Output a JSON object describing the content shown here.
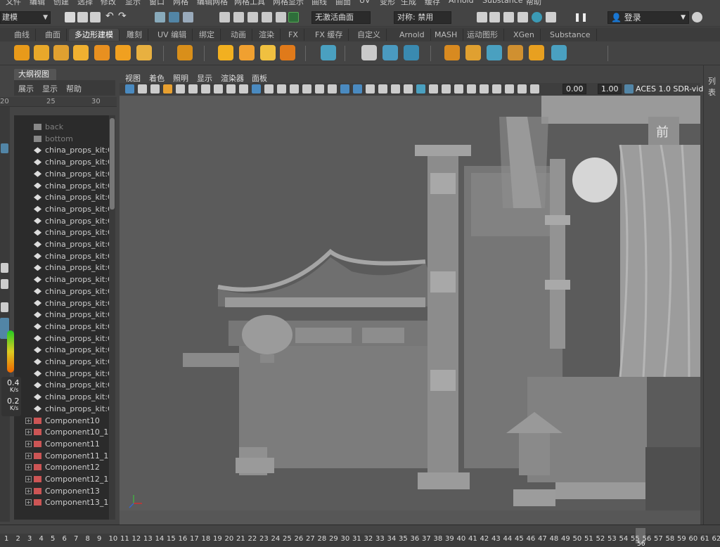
{
  "menubar": {
    "items": [
      "文件",
      "编辑",
      "创建",
      "选择",
      "修改",
      "显示",
      "窗口",
      "网格",
      "编辑网格",
      "网格工具",
      "网格显示",
      "曲线",
      "曲面",
      "UV",
      "变形",
      "生成",
      "缓存",
      "Arnold",
      "Substance",
      "帮助"
    ]
  },
  "statusline": {
    "mode": "建模",
    "live_surface": "无激活曲面",
    "symmetry": "对称: 禁用",
    "login": "登录"
  },
  "shelf_tabs": [
    "曲线",
    "曲面",
    "多边形建模",
    "雕刻",
    "UV 编辑",
    "绑定",
    "动画",
    "渲染",
    "FX",
    "FX 缓存",
    "自定义",
    "Arnold",
    "MASH",
    "运动图形",
    "XGen",
    "Substance"
  ],
  "shelf_active": "多边形建模",
  "shelf_icons": [
    "sphere-icon",
    "cube-icon",
    "cylinder-icon",
    "cone-icon",
    "torus-icon",
    "plane-icon",
    "disc-icon",
    "platonic-icon",
    "super-shape-icon",
    "sweep-mesh-icon",
    "text-icon",
    "svg-icon",
    "sphere-uv-icon",
    "combine-icon",
    "separate-icon",
    "smooth-icon",
    "boolean-icon",
    "bridge-icon",
    "extrude-icon",
    "bevel-icon",
    "merge-icon",
    "insert-loop-icon"
  ],
  "outliner": {
    "title": "大纲视图",
    "menu": [
      "展示",
      "显示",
      "帮助"
    ],
    "ruler": [
      "20",
      "25",
      "30"
    ],
    "items": [
      {
        "label": "back",
        "dim": true,
        "type": "camera"
      },
      {
        "label": "bottom",
        "dim": true,
        "type": "camera"
      },
      {
        "label": "china_props_kit:Gr",
        "type": "group"
      },
      {
        "label": "china_props_kit:Gr",
        "type": "group"
      },
      {
        "label": "china_props_kit:Gr",
        "type": "group"
      },
      {
        "label": "china_props_kit:Gr",
        "type": "group"
      },
      {
        "label": "china_props_kit:Gr",
        "type": "group"
      },
      {
        "label": "china_props_kit:Gr",
        "type": "group"
      },
      {
        "label": "china_props_kit:Gr",
        "type": "group"
      },
      {
        "label": "china_props_kit:Gr",
        "type": "group"
      },
      {
        "label": "china_props_kit:Gr",
        "type": "group"
      },
      {
        "label": "china_props_kit:Gr",
        "type": "group"
      },
      {
        "label": "china_props_kit:Gr",
        "type": "group"
      },
      {
        "label": "china_props_kit:Gr",
        "type": "group"
      },
      {
        "label": "china_props_kit:Gr",
        "type": "group"
      },
      {
        "label": "china_props_kit:Gr",
        "type": "group"
      },
      {
        "label": "china_props_kit:Gr",
        "type": "group"
      },
      {
        "label": "china_props_kit:Gr",
        "type": "group"
      },
      {
        "label": "china_props_kit:Gr",
        "type": "group"
      },
      {
        "label": "china_props_kit:Gr",
        "type": "group"
      },
      {
        "label": "china_props_kit:Gr",
        "type": "group"
      },
      {
        "label": "china_props_kit:Gr",
        "type": "group"
      },
      {
        "label": "china_props_kit:Gr",
        "type": "group"
      },
      {
        "label": "china_props_kit:Gr",
        "type": "group"
      },
      {
        "label": "china_props_kit:Gr",
        "type": "group"
      },
      {
        "label": "Component10",
        "type": "component"
      },
      {
        "label": "Component10_1",
        "type": "component"
      },
      {
        "label": "Component11",
        "type": "component"
      },
      {
        "label": "Component11_1",
        "type": "component"
      },
      {
        "label": "Component12",
        "type": "component"
      },
      {
        "label": "Component12_1",
        "type": "component"
      },
      {
        "label": "Component13",
        "type": "component"
      },
      {
        "label": "Component13_1",
        "type": "component"
      }
    ]
  },
  "speed_widget": {
    "up": "0.4",
    "up_unit": "K/s",
    "down": "0.2",
    "down_unit": "K/s"
  },
  "viewport": {
    "menu": [
      "视图",
      "着色",
      "照明",
      "显示",
      "渲染器",
      "面板"
    ],
    "exposure": "0.00",
    "gamma": "1.00",
    "color_space": "ACES 1.0 SDR-vide",
    "sign_text": "前"
  },
  "right_panel": {
    "label": "列表"
  },
  "time_slider": {
    "numbers": [
      "1",
      "2",
      "3",
      "4",
      "5",
      "6",
      "7",
      "8",
      "9",
      "10",
      "11",
      "12",
      "13",
      "14",
      "15",
      "16",
      "17",
      "18",
      "19",
      "20",
      "21",
      "22",
      "23",
      "24",
      "25",
      "26",
      "27",
      "28",
      "29",
      "30",
      "31",
      "32",
      "33",
      "34",
      "35",
      "36",
      "37",
      "38",
      "39",
      "40",
      "41",
      "42",
      "43",
      "44",
      "45",
      "46",
      "47",
      "48",
      "49",
      "50",
      "51",
      "52",
      "53",
      "54",
      "55",
      "56",
      "57",
      "58",
      "59",
      "60",
      "61",
      "62"
    ],
    "current": "56"
  },
  "colors": {
    "accent": "#5285a6",
    "active_tab": "#4a4a4a",
    "panel": "#444444",
    "viewport_bg": "#5a5a5a"
  }
}
